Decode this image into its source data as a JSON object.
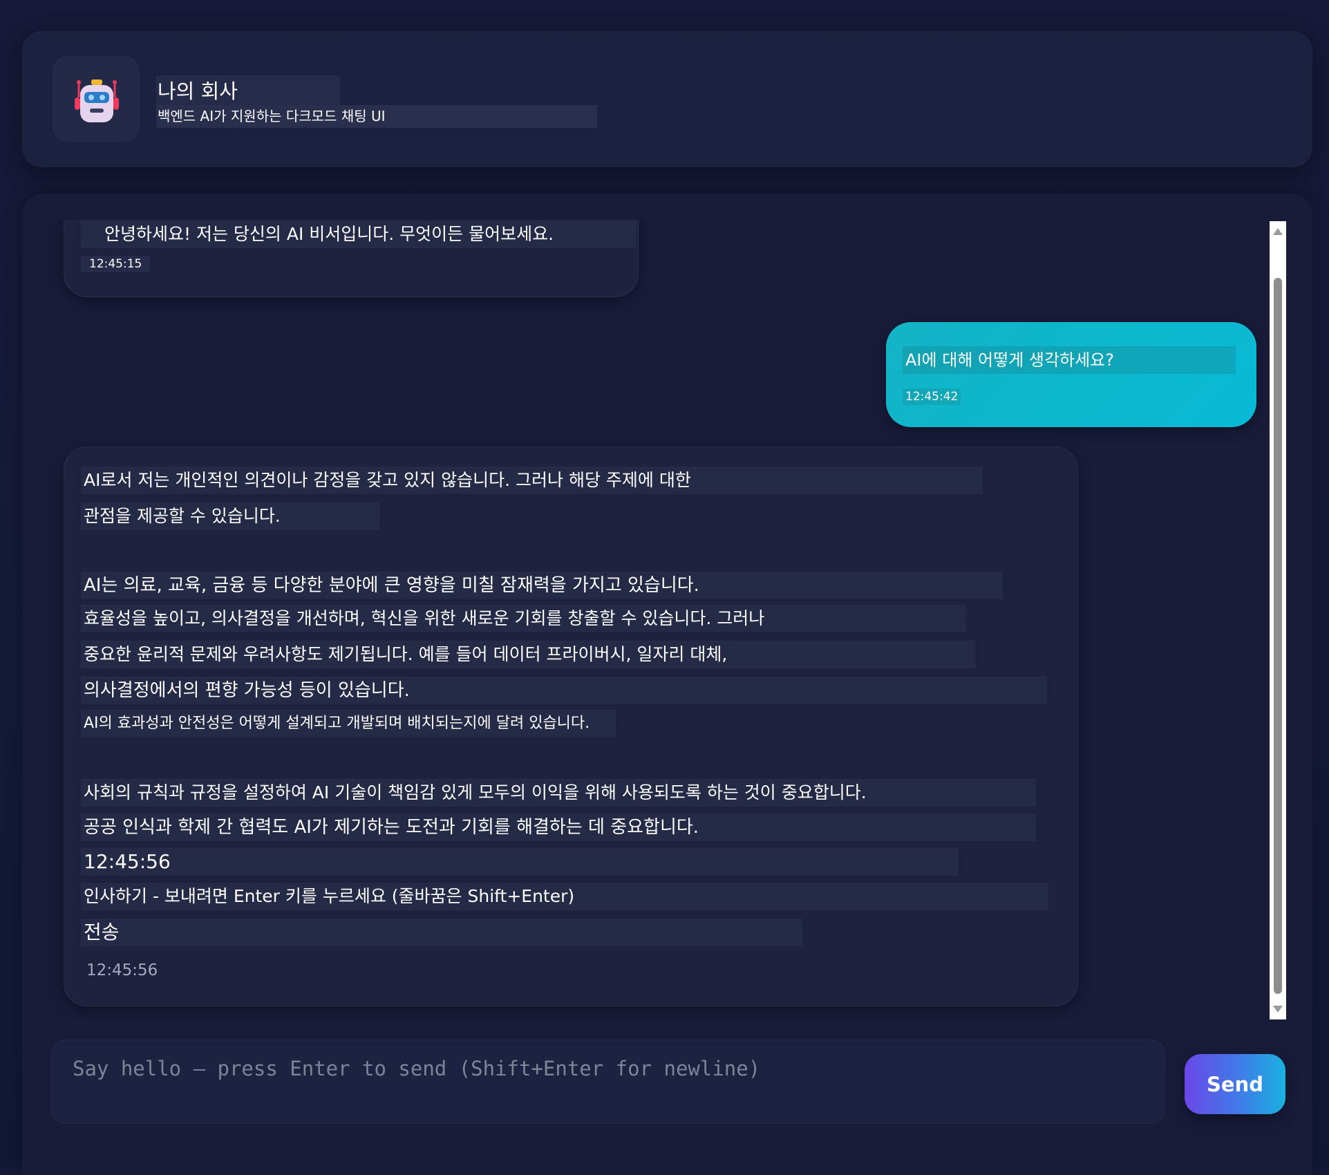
{
  "header": {
    "title": "나의 회사",
    "subtitle": "백엔드 AI가 지원하는 다크모드 채팅 UI",
    "avatar_icon": "robot-icon"
  },
  "messages": [
    {
      "role": "ai",
      "lines": [
        "안녕하세요! 저는 당신의 AI 비서입니다. 무엇이든 물어보세요."
      ],
      "time": "12:45:15"
    },
    {
      "role": "user",
      "text": "AI에 대해 어떻게 생각하세요?",
      "time": "12:45:42"
    },
    {
      "role": "ai",
      "lines": [
        "AI로서 저는 개인적인 의견이나 감정을 갖고 있지 않습니다. 그러나 해당 주제에 대한",
        "관점을 제공할 수 있습니다.",
        "AI는 의료, 교육, 금융 등 다양한 분야에 큰 영향을 미칠 잠재력을 가지고 있습니다.",
        "효율성을 높이고, 의사결정을 개선하며, 혁신을 위한 새로운 기회를 창출할 수 있습니다. 그러나",
        "중요한 윤리적 문제와 우려사항도 제기됩니다. 예를 들어 데이터 프라이버시, 일자리 대체,",
        "의사결정에서의 편향 가능성 등이 있습니다.",
        "AI의 효과성과 안전성은 어떻게 설계되고 개발되며 배치되는지에 달려 있습니다.",
        "사회의 규칙과 규정을 설정하여 AI 기술이 책임감 있게 모두의 이익을 위해 사용되도록 하는 것이 중요합니다.",
        "공공 인식과 학제 간 협력도 AI가 제기하는 도전과 기회를 해결하는 데 중요합니다.",
        "12:45:56",
        "인사하기 - 보내려면 Enter 키를 누르세요 (줄바꿈은 Shift+Enter)",
        "전송"
      ],
      "time": "12:45:56"
    }
  ],
  "composer": {
    "placeholder": "Say hello — press Enter to send (Shift+Enter for newline)",
    "value": ""
  },
  "send_label": "Send",
  "colors": {
    "background": "#161937",
    "panel": "#1d2140",
    "user_bubble": "#0cb8cd",
    "send_gradient_start": "#6b47e8",
    "send_gradient_end": "#1ab1e0"
  }
}
